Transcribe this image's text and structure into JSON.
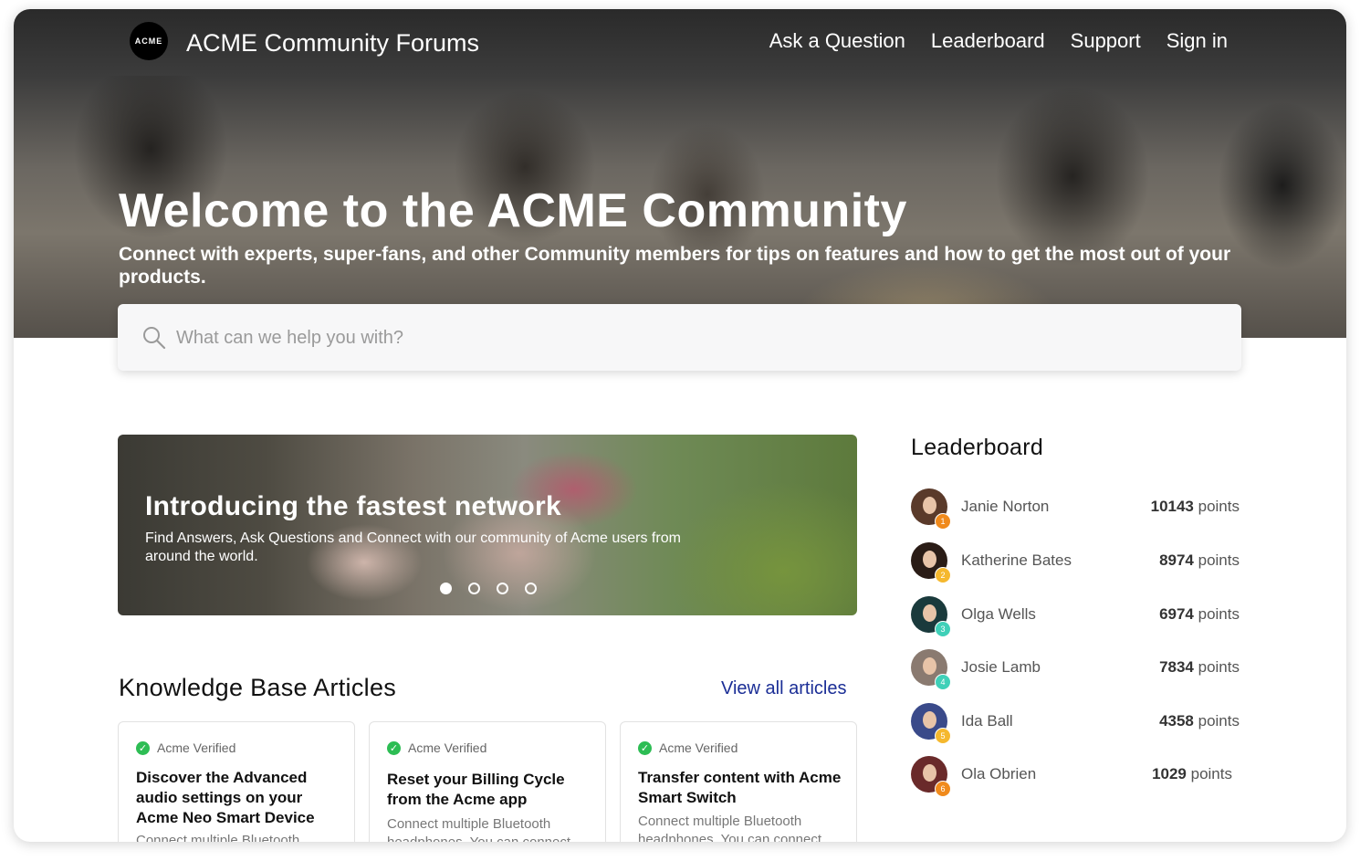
{
  "header": {
    "logo_text": "ACME",
    "site_title": "ACME Community Forums",
    "nav": [
      "Ask a Question",
      "Leaderboard",
      "Support",
      "Sign in"
    ]
  },
  "hero": {
    "title": "Welcome to the ACME Community",
    "subtitle": "Connect with experts, super-fans, and other Community members for tips on features and how to get the most out of your products."
  },
  "search": {
    "placeholder": "What can we help you with?",
    "icon": "search-icon"
  },
  "carousel": {
    "title": "Introducing the fastest network",
    "text": "Find Answers, Ask Questions and Connect with our community of Acme users from around the world.",
    "slide_count": 4,
    "active_slide": 1
  },
  "kb": {
    "title": "Knowledge Base Articles",
    "view_all": "View all articles",
    "articles": [
      {
        "badge": "Acme Verified",
        "title": "Discover the Advanced audio settings on your Acme Neo Smart Device",
        "desc": "Connect multiple Bluetooth headphones. You can connect"
      },
      {
        "badge": "Acme Verified",
        "title": "Reset your Billing Cycle from the Acme app",
        "desc": "Connect multiple Bluetooth headphones. You can connect"
      },
      {
        "badge": "Acme Verified",
        "title": "Transfer content with Acme Smart Switch",
        "desc": "Connect multiple Bluetooth headphones. You can connect"
      }
    ]
  },
  "leaderboard": {
    "title": "Leaderboard",
    "entries": [
      {
        "rank": "1",
        "name": "Janie Norton",
        "points": "10143",
        "unit": "points",
        "badge_color": "#f08a1c"
      },
      {
        "rank": "2",
        "name": "Katherine Bates",
        "points": "8974",
        "unit": "points",
        "badge_color": "#f5b82e"
      },
      {
        "rank": "3",
        "name": "Olga Wells",
        "points": "6974",
        "unit": "points",
        "badge_color": "#3fd0b8"
      },
      {
        "rank": "4",
        "name": "Josie Lamb",
        "points": "7834",
        "unit": "points",
        "badge_color": "#3fd0b8"
      },
      {
        "rank": "5",
        "name": "Ida Ball",
        "points": "4358",
        "unit": "points",
        "badge_color": "#f5b82e"
      },
      {
        "rank": "6",
        "name": "Ola Obrien",
        "points": "1029",
        "unit": "points",
        "badge_color": "#f08a1c"
      }
    ]
  }
}
